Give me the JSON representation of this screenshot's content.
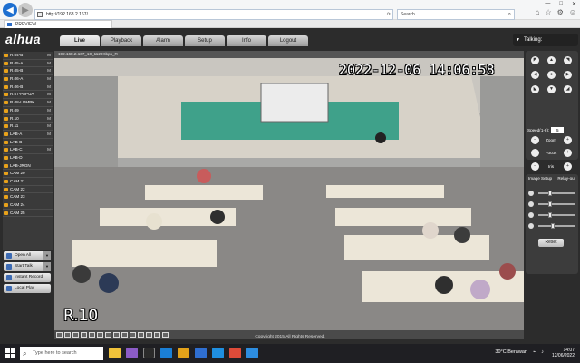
{
  "browser": {
    "url": "http://192.168.2.167/",
    "search_placeholder": "Search...",
    "tab_title": "PREVIEW"
  },
  "app": {
    "logo": "alhua",
    "nav": [
      "Live",
      "Playback",
      "Alarm",
      "Setup",
      "Info",
      "Logout"
    ],
    "talking": "Talking:",
    "copyright": "Copyright 2015,All Rights Reserved."
  },
  "channels": [
    {
      "label": "R.04-B",
      "mark": "M"
    },
    {
      "label": "R.05-A",
      "mark": "M"
    },
    {
      "label": "R.05-B",
      "mark": "M"
    },
    {
      "label": "R.06-A",
      "mark": "M"
    },
    {
      "label": "R.06-B",
      "mark": "M"
    },
    {
      "label": "R.07-PAPUA",
      "mark": "M"
    },
    {
      "label": "R.08-LOMBK",
      "mark": "M"
    },
    {
      "label": "R.09",
      "mark": "M"
    },
    {
      "label": "R.10",
      "mark": "M"
    },
    {
      "label": "R.11",
      "mark": "M"
    },
    {
      "label": "LAB-A",
      "mark": "M"
    },
    {
      "label": "LAB-B",
      "mark": ""
    },
    {
      "label": "LAB-C",
      "mark": "M"
    },
    {
      "label": "LAB-D",
      "mark": ""
    },
    {
      "label": "LAB-JRGN",
      "mark": ""
    },
    {
      "label": "CAM 20",
      "mark": ""
    },
    {
      "label": "CAM 21",
      "mark": ""
    },
    {
      "label": "CAM 22",
      "mark": ""
    },
    {
      "label": "CAM 23",
      "mark": ""
    },
    {
      "label": "CAM 24",
      "mark": ""
    },
    {
      "label": "CAM 25",
      "mark": ""
    }
  ],
  "sidebar_buttons": {
    "open_all": "Open All",
    "start_talk": "Start Talk",
    "instant_record": "Instant Record",
    "local_play": "Local Play"
  },
  "video": {
    "header": "192.168.2.167_10_1129Kbps_R",
    "timestamp": "2022-12-06 14:06:58",
    "camera_name": "R.10"
  },
  "ptz": {
    "speed_label": "Speed(1-8):",
    "speed_value": "5",
    "zoom": "Zoom",
    "focus": "Focus",
    "iris": "Iris"
  },
  "image_setup": {
    "tab1": "Image Setup",
    "tab2": "Relay-out",
    "levels": [
      0.3,
      0.3,
      0.3,
      0.4
    ],
    "reset": "Reset"
  },
  "taskbar": {
    "search_placeholder": "Type here to search",
    "weather": "30°C  Berawan",
    "time": "14:07",
    "date": "12/06/2022"
  },
  "colors": {
    "accent": "#d11c1c",
    "chan_icon": "#e8a21b"
  }
}
